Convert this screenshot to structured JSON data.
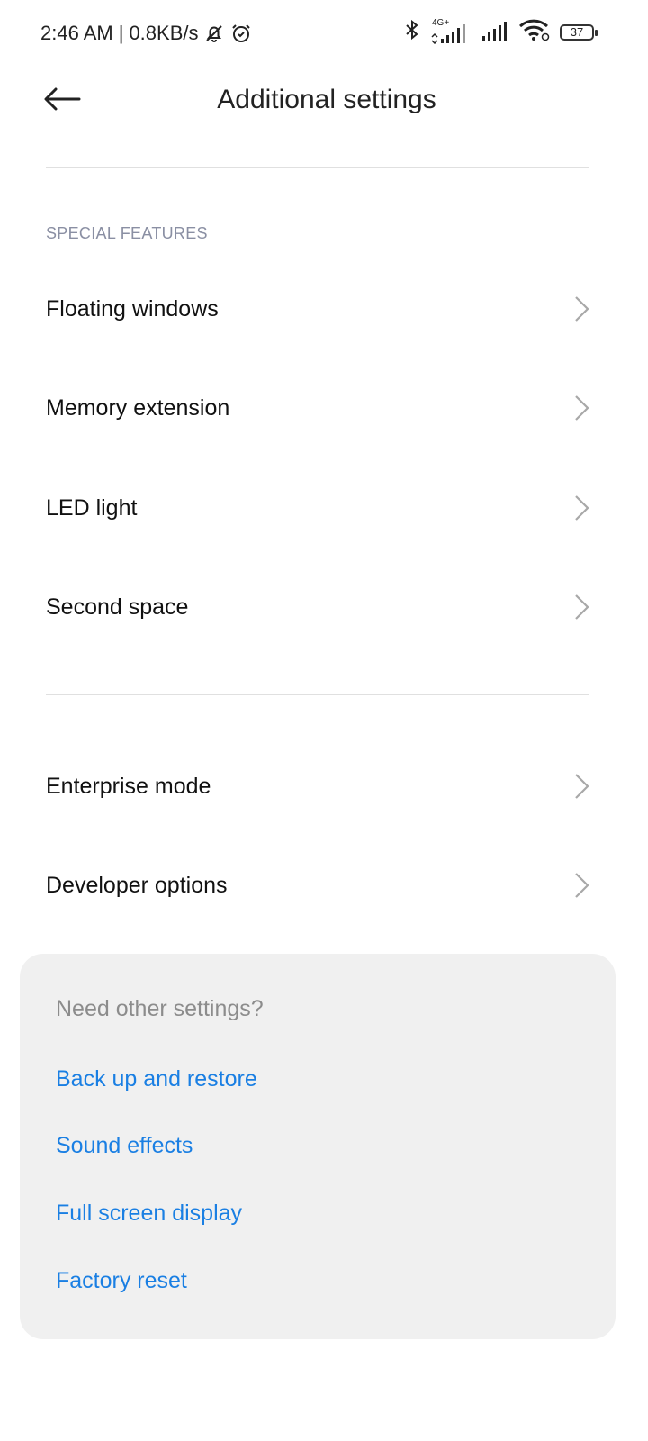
{
  "status_bar": {
    "time": "2:46 AM",
    "separator": "|",
    "speed": "0.8KB/s",
    "network_label": "4G+",
    "battery": "37",
    "icons": [
      "mute-bell-icon",
      "alarm-icon",
      "bluetooth-icon",
      "signal-4g-icon",
      "signal-icon",
      "wifi-icon",
      "battery-icon"
    ]
  },
  "header": {
    "title": "Additional settings",
    "back_icon": "back-arrow-icon"
  },
  "special_features": {
    "section_title": "SPECIAL FEATURES",
    "items": [
      {
        "label": "Floating windows"
      },
      {
        "label": "Memory extension"
      },
      {
        "label": "LED light"
      },
      {
        "label": "Second space"
      }
    ]
  },
  "other_items": [
    {
      "label": "Enterprise mode"
    },
    {
      "label": "Developer options"
    }
  ],
  "other_settings": {
    "title": "Need other settings?",
    "links": [
      {
        "label": "Back up and restore"
      },
      {
        "label": "Sound effects"
      },
      {
        "label": "Full screen display"
      },
      {
        "label": "Factory reset"
      }
    ]
  },
  "colors": {
    "link": "#1a7fe3",
    "section_label": "#8a8fa3",
    "card_background": "#f0f0f0"
  }
}
